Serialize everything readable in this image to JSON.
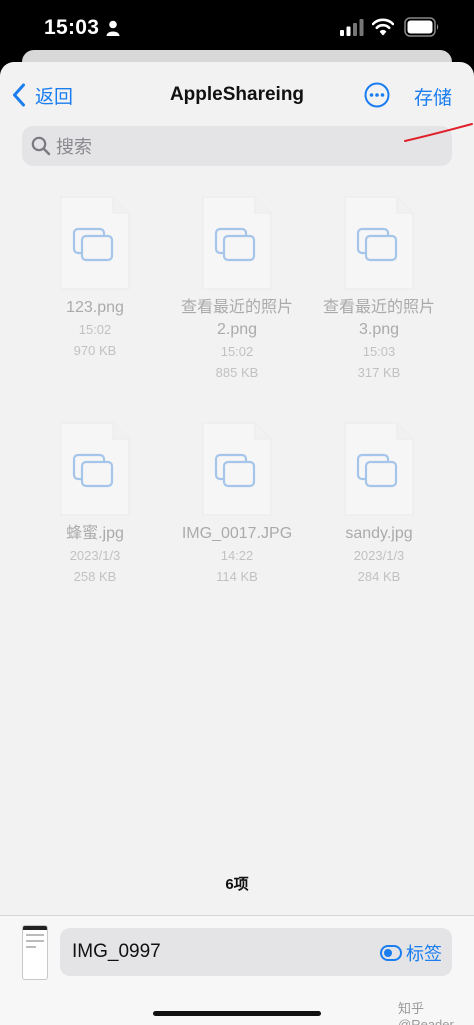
{
  "status_bar": {
    "time": "15:03",
    "icons": [
      "person-icon",
      "signal-icon",
      "wifi-icon",
      "battery-icon"
    ]
  },
  "nav": {
    "back_label": "返回",
    "title": "AppleShareing",
    "save_label": "存储",
    "more_icon": "ellipsis-circle-icon"
  },
  "search": {
    "placeholder": "搜索"
  },
  "files": [
    {
      "name": "123.png",
      "time": "15:02",
      "size": "970 KB"
    },
    {
      "name": "查看最近的照片 2.png",
      "time": "15:02",
      "size": "885 KB"
    },
    {
      "name": "查看最近的照片 3.png",
      "time": "15:03",
      "size": "317 KB"
    },
    {
      "name": "蜂蜜.jpg",
      "time": "2023/1/3",
      "size": "258 KB"
    },
    {
      "name": "IMG_0017.JPG",
      "time": "14:22",
      "size": "114 KB"
    },
    {
      "name": "sandy.jpg",
      "time": "2023/1/3",
      "size": "284 KB"
    }
  ],
  "item_count": "6项",
  "bottom": {
    "filename": "IMG_0997",
    "tags_label": "标签",
    "watermark": "知乎 @Reader"
  },
  "colors": {
    "accent": "#1a7df0",
    "annotation_red": "#e0202a",
    "background": "#f2f2f2"
  }
}
